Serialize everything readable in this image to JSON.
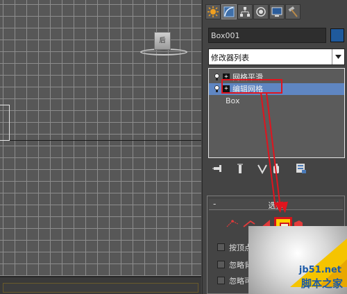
{
  "viewport": {
    "viewcube_label": "后"
  },
  "command_panel": {
    "tabs": [
      {
        "name": "create-tab",
        "icon": "sun-icon"
      },
      {
        "name": "modify-tab",
        "icon": "curve-icon"
      },
      {
        "name": "hierarchy-tab",
        "icon": "hierarchy-icon"
      },
      {
        "name": "motion-tab",
        "icon": "motion-icon"
      },
      {
        "name": "display-tab",
        "icon": "monitor-icon"
      },
      {
        "name": "utilities-tab",
        "icon": "hammer-icon"
      }
    ],
    "object_name": "Box001",
    "object_color": "#1f5a9c",
    "modifier_list": "修改器列表",
    "stack": [
      {
        "label": "网格平滑",
        "expand": "+",
        "selected": false
      },
      {
        "label": "编辑网格",
        "expand": "+",
        "selected": true
      },
      {
        "label": "Box",
        "base": true
      }
    ],
    "selection_rollout": {
      "collapse": "-",
      "title": "选择",
      "checkboxes": [
        {
          "label": "按顶点"
        },
        {
          "label": "忽略背面"
        },
        {
          "label": "忽略可见边"
        }
      ]
    }
  },
  "annotation_colors": {
    "highlight": "#e0141e"
  },
  "watermark": {
    "site": "jb51.net",
    "name": "脚本之家"
  }
}
